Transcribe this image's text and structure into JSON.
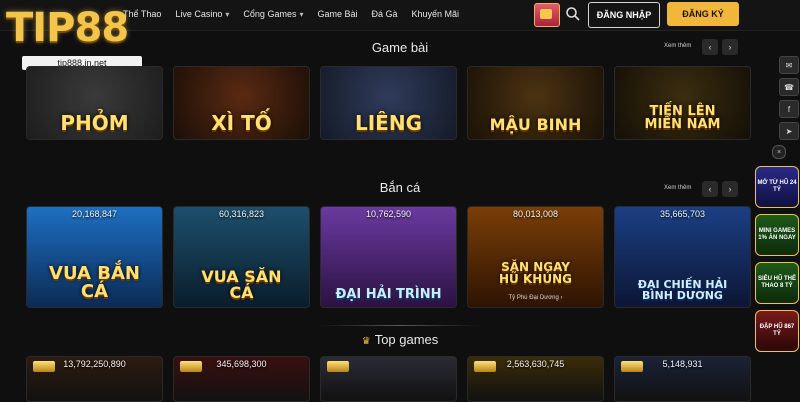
{
  "brand": {
    "logo_text": "TIP88",
    "logo_small": "TIP88",
    "domain": "tip888.in.net"
  },
  "nav": [
    {
      "label": "Thể Thao",
      "dropdown": false
    },
    {
      "label": "Live Casino",
      "dropdown": true
    },
    {
      "label": "Cổng Games",
      "dropdown": true
    },
    {
      "label": "Game Bài",
      "dropdown": false
    },
    {
      "label": "Đá Gà",
      "dropdown": false
    },
    {
      "label": "Khuyến Mãi",
      "dropdown": false
    }
  ],
  "header_actions": {
    "login": "ĐĂNG NHẬP",
    "register": "ĐĂNG KÝ"
  },
  "sections": {
    "game_bai": {
      "title": "Game bài",
      "see_more": "Xem thêm",
      "cards": [
        {
          "title": "PHỎM"
        },
        {
          "title": "XÌ TỐ"
        },
        {
          "title": "LIÊNG"
        },
        {
          "title": "MẬU BINH"
        },
        {
          "title": "TIẾN LÊN MIỀN NAM"
        }
      ]
    },
    "ban_ca": {
      "title": "Bắn cá",
      "see_more": "Xem thêm",
      "cards": [
        {
          "jackpot": "20,168,847",
          "title": "VUA BẮN CÁ",
          "sub": ""
        },
        {
          "jackpot": "60,316,823",
          "title": "VUA SĂN CÁ",
          "sub": ""
        },
        {
          "jackpot": "10,762,590",
          "title": "ĐẠI HẢI TRÌNH",
          "sub": ""
        },
        {
          "jackpot": "80,013,008",
          "title": "SĂN NGAY HŨ KHỦNG",
          "sub": "Tỷ Phú Đại Dương ›"
        },
        {
          "jackpot": "35,665,703",
          "title": "ĐẠI CHIẾN HẢI BÌNH DƯƠNG",
          "sub": ""
        }
      ]
    },
    "top_games": {
      "title": "Top games",
      "cards": [
        {
          "jackpot": "13,792,250,890"
        },
        {
          "jackpot": "345,698,300"
        },
        {
          "jackpot": ""
        },
        {
          "jackpot": "2,563,630,745"
        },
        {
          "jackpot": "5,148,931"
        }
      ]
    }
  },
  "side_promos": [
    {
      "label": "MỞ TỪ HŨ 24 TỶ"
    },
    {
      "label": "MINI GAMES 1% ĂN NGAY"
    },
    {
      "label": "SIÊU HŨ THỂ THAO 8 TỶ"
    },
    {
      "label": "ĐẬP HŨ 867 TỶ"
    }
  ],
  "colors": {
    "accent": "#f0b73b",
    "background": "#0f0f10"
  }
}
